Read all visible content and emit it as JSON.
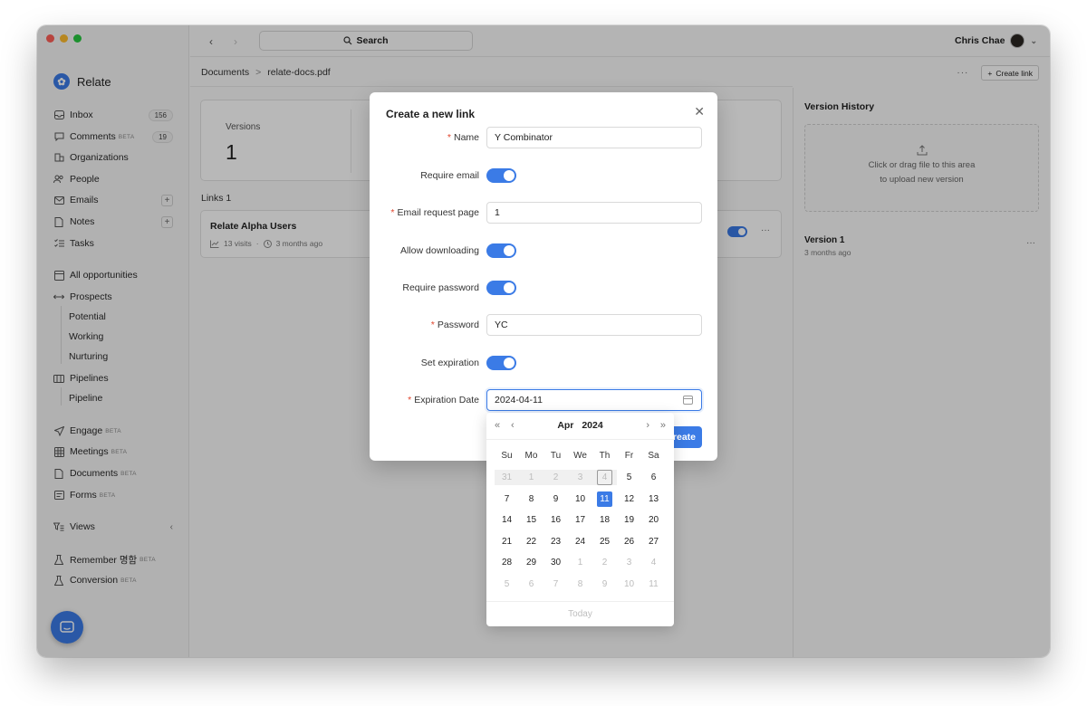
{
  "sidebar": {
    "brand": "Relate",
    "items": [
      {
        "label": "Inbox",
        "count": "156"
      },
      {
        "label": "Comments",
        "beta": "BETA",
        "count": "19"
      },
      {
        "label": "Organizations"
      },
      {
        "label": "People"
      },
      {
        "label": "Emails",
        "plus": "+"
      },
      {
        "label": "Notes",
        "plus": "+"
      },
      {
        "label": "Tasks"
      },
      {
        "label": "All opportunities"
      },
      {
        "label": "Prospects"
      },
      {
        "label": "Potential"
      },
      {
        "label": "Working"
      },
      {
        "label": "Nurturing"
      },
      {
        "label": "Pipelines"
      },
      {
        "label": "Pipeline"
      },
      {
        "label": "Engage",
        "beta": "BETA"
      },
      {
        "label": "Meetings",
        "beta": "BETA"
      },
      {
        "label": "Documents",
        "beta": "BETA"
      },
      {
        "label": "Forms",
        "beta": "BETA"
      },
      {
        "label": "Views"
      },
      {
        "label": "Remember 명함",
        "beta": "BETA"
      },
      {
        "label": "Conversion",
        "beta": "BETA"
      }
    ]
  },
  "topbar": {
    "search_label": "Search",
    "user_name": "Chris Chae"
  },
  "breadcrumb": {
    "parent": "Documents",
    "separator": ">",
    "current": "relate-docs.pdf",
    "more": "···",
    "create_link": "Create link"
  },
  "main": {
    "stats_label": "Versions",
    "stats_value": "1",
    "links_title": "Links 1",
    "link": {
      "name": "Relate Alpha Users",
      "visits": "13 visits",
      "dot": "·",
      "time": "3 months ago",
      "more": "···"
    }
  },
  "right_panel": {
    "title": "Version History",
    "upload_line1": "Click or drag file to this area",
    "upload_line2": "to upload new version",
    "version_name": "Version 1",
    "version_time": "3 months ago",
    "more": "···"
  },
  "modal": {
    "title": "Create a new link",
    "required_mark": "*",
    "fields": {
      "name_label": "Name",
      "name_value": "Y Combinator",
      "require_email_label": "Require email",
      "email_page_label": "Email request page",
      "email_page_value": "1",
      "allow_downloading_label": "Allow downloading",
      "require_password_label": "Require password",
      "password_label": "Password",
      "password_value": "YC",
      "set_expiration_label": "Set expiration",
      "expiration_label": "Expiration Date",
      "expiration_value": "2024-04-11"
    },
    "create_label": "Create",
    "close": "✕"
  },
  "datepicker": {
    "month": "Apr",
    "year": "2024",
    "weekdays": [
      "Su",
      "Mo",
      "Tu",
      "We",
      "Th",
      "Fr",
      "Sa"
    ],
    "days": [
      "31",
      "1",
      "2",
      "3",
      "4",
      "5",
      "6",
      "7",
      "8",
      "9",
      "10",
      "11",
      "12",
      "13",
      "14",
      "15",
      "16",
      "17",
      "18",
      "19",
      "20",
      "21",
      "22",
      "23",
      "24",
      "25",
      "26",
      "27",
      "28",
      "29",
      "30",
      "1",
      "2",
      "3",
      "4",
      "5",
      "6",
      "7",
      "8",
      "9",
      "10",
      "11"
    ],
    "today_label": "Today"
  }
}
